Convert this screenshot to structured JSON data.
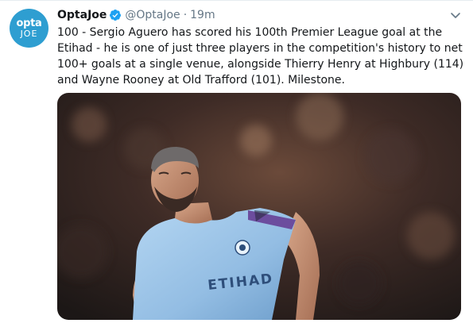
{
  "author": {
    "avatar_top_text": "opta",
    "avatar_bottom_text": "JOE",
    "display_name": "OptaJoe",
    "handle": "@OptaJoe",
    "separator": "·",
    "timestamp": "19m"
  },
  "tweet": {
    "text": "100 - Sergio Aguero has scored his 100th Premier League goal at the Etihad - he is one of  just three players in the competition's history to net 100+ goals at a single venue, alongside Thierry Henry at Highbury (114) and Wayne Rooney at Old Trafford (101). Milestone."
  },
  "media": {
    "shirt_sponsor": "ETIHAD"
  },
  "colors": {
    "avatar_bg": "#2e9ed1",
    "verified_badge": "#1da1f2",
    "shirt_sky_blue": "#9ec5e8",
    "secondary_text": "#657786"
  },
  "icons": {
    "verified": "verified-badge-icon",
    "menu": "chevron-down-icon"
  }
}
